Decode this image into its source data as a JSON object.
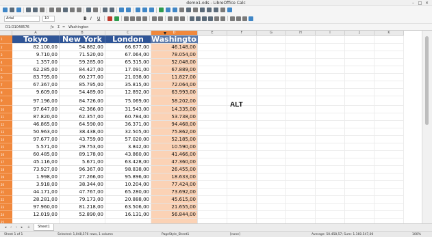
{
  "window": {
    "title": "demo1.ods - LibreOffice Calc"
  },
  "toolbar": {
    "font_name": "Arial",
    "font_size": "10",
    "bold": "B",
    "italic": "I",
    "underline": "U"
  },
  "formula_bar": {
    "cell_ref": "D1:D1048576",
    "sum_symbol": "Σ",
    "equals_symbol": "=",
    "content": "Washington"
  },
  "columns": [
    "A",
    "B",
    "C",
    "D",
    "E",
    "F",
    "G",
    "H",
    "I",
    "J",
    "K"
  ],
  "table": {
    "headers": [
      "Tokyo",
      "New York",
      "London",
      "Washington"
    ],
    "rows": [
      [
        "82.100,00",
        "54.882,00",
        "66.677,00",
        "46.148,00"
      ],
      [
        "9.710,00",
        "71.520,00",
        "67.064,00",
        "78.054,00"
      ],
      [
        "1.357,00",
        "59.285,00",
        "65.315,00",
        "52.048,00"
      ],
      [
        "62.285,00",
        "84.427,00",
        "17.091,00",
        "67.889,00"
      ],
      [
        "83.795,00",
        "60.277,00",
        "21.038,00",
        "11.827,00"
      ],
      [
        "67.367,00",
        "85.795,00",
        "35.815,00",
        "72.064,00"
      ],
      [
        "9.609,00",
        "54.489,00",
        "12.892,00",
        "63.993,00"
      ],
      [
        "97.196,00",
        "84.726,00",
        "75.069,00",
        "58.202,00"
      ],
      [
        "97.647,00",
        "42.366,00",
        "31.543,00",
        "14.335,00"
      ],
      [
        "87.820,00",
        "62.357,00",
        "60.784,00",
        "53.738,00"
      ],
      [
        "46.865,00",
        "64.590,00",
        "36.371,00",
        "94.468,00"
      ],
      [
        "50.963,00",
        "38.438,00",
        "32.505,00",
        "75.862,00"
      ],
      [
        "97.677,00",
        "43.759,00",
        "57.020,00",
        "52.185,00"
      ],
      [
        "5.571,00",
        "29.753,00",
        "3.842,00",
        "10.590,00"
      ],
      [
        "60.485,00",
        "89.178,00",
        "43.860,00",
        "41.466,00"
      ],
      [
        "45.116,00",
        "5.671,00",
        "63.428,00",
        "47.360,00"
      ],
      [
        "73.927,00",
        "96.367,00",
        "98.838,00",
        "26.455,00"
      ],
      [
        "1.998,00",
        "27.266,00",
        "95.896,00",
        "18.633,00"
      ],
      [
        "3.918,00",
        "38.344,00",
        "10.204,00",
        "77.424,00"
      ],
      [
        "44.171,00",
        "47.767,00",
        "65.280,00",
        "73.692,00"
      ],
      [
        "28.281,00",
        "79.173,00",
        "20.888,00",
        "45.615,00"
      ],
      [
        "97.960,00",
        "81.218,00",
        "63.506,00",
        "21.655,00"
      ],
      [
        "12.019,00",
        "52.890,00",
        "16.131,00",
        "56.844,00"
      ]
    ]
  },
  "floating_text": "ALT",
  "sheet_tabs": [
    "Sheet1"
  ],
  "status_bar": {
    "sheet": "Sheet 1 of 1",
    "selection": "Selected: 1,048,576 rows, 1 column",
    "page_style": "PageStyle_Sheet1",
    "language": "[none]",
    "summary": "Average: 50.458,57; Sum: 1.160.547,00",
    "zoom": "100%"
  },
  "colors": {
    "header_bg": "#2f5597",
    "selection_orange": "#f0883c",
    "selected_cells": "#fbd2b5"
  }
}
